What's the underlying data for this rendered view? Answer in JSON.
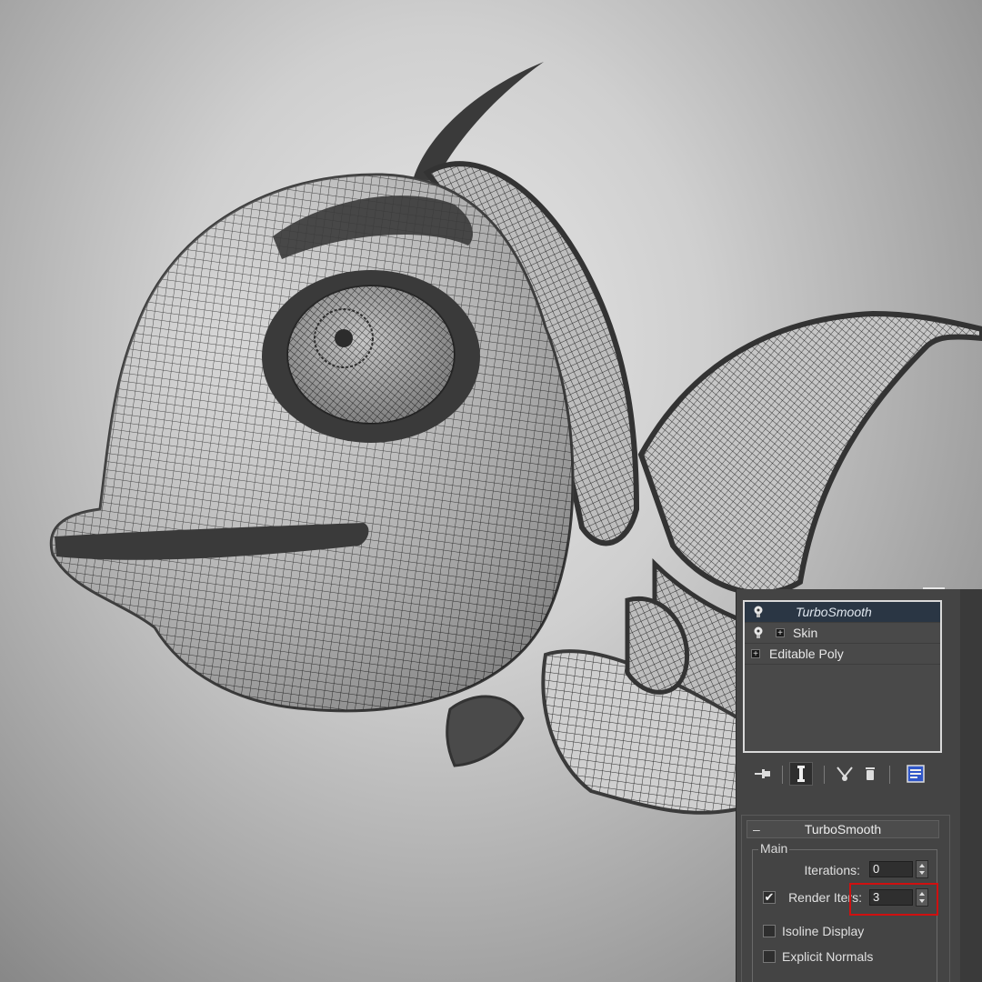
{
  "modifier_stack": {
    "items": [
      {
        "label": "TurboSmooth",
        "selected": true,
        "icon": "lightbulb-icon"
      },
      {
        "label": "Skin",
        "selected": false,
        "icon": "lightbulb-icon",
        "expand": "plus-icon"
      },
      {
        "label": "Editable Poly",
        "selected": false,
        "expand": "plus-icon"
      }
    ]
  },
  "toolbar": {
    "buttons": [
      "pin-stack-icon",
      "show-end-result-icon",
      "make-unique-icon",
      "remove-modifier-icon",
      "configure-modifier-sets-icon"
    ]
  },
  "turbosmooth": {
    "title": "TurboSmooth",
    "collapse_symbol": "–",
    "group_main": "Main",
    "iterations_label": "Iterations:",
    "iterations_value": "0",
    "render_iters_label": "Render Iters:",
    "render_iters_value": "3",
    "render_iters_checked": true,
    "isoline_label": "Isoline Display",
    "isoline_checked": false,
    "explicit_normals_label": "Explicit Normals",
    "explicit_normals_checked": false,
    "check_mark": "✔"
  },
  "colors": {
    "viewport_bg": "#d8d8d8",
    "panel_bg": "#444444",
    "selected_row": "#2a3644",
    "highlight_box": "#d01010",
    "mesh_dark": "#3a3a3a"
  }
}
